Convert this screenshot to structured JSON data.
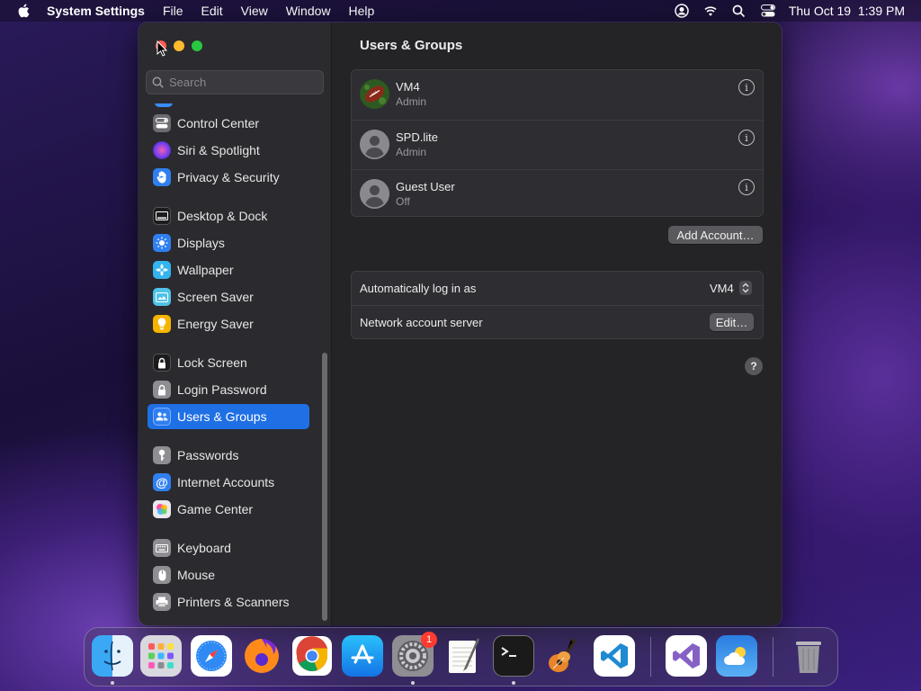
{
  "menubar": {
    "app_name": "System Settings",
    "menus": [
      "File",
      "Edit",
      "View",
      "Window",
      "Help"
    ],
    "clock": "Thu Oct 19  1:39 PM"
  },
  "sidebar": {
    "search_placeholder": "Search",
    "items": [
      {
        "label": "Control Center",
        "icon": "control-center-icon",
        "color": "#6b6b70"
      },
      {
        "label": "Siri & Spotlight",
        "icon": "siri-icon",
        "color": "#b14fd6"
      },
      {
        "label": "Privacy & Security",
        "icon": "hand-icon",
        "color": "#2f7ff0"
      },
      {
        "label": "Desktop & Dock",
        "icon": "dock-icon",
        "color": "#1c1c1e"
      },
      {
        "label": "Displays",
        "icon": "sun-icon",
        "color": "#2f7ff0"
      },
      {
        "label": "Wallpaper",
        "icon": "flower-icon",
        "color": "#33b4ee"
      },
      {
        "label": "Screen Saver",
        "icon": "screen-saver-icon",
        "color": "#4fc3e8"
      },
      {
        "label": "Energy Saver",
        "icon": "bulb-icon",
        "color": "#f5b400"
      },
      {
        "label": "Lock Screen",
        "icon": "lock-icon",
        "color": "#1c1c1e"
      },
      {
        "label": "Login Password",
        "icon": "padlock-icon",
        "color": "#8e8e93"
      },
      {
        "label": "Users & Groups",
        "icon": "users-icon",
        "color": "#2f7ff0"
      },
      {
        "label": "Passwords",
        "icon": "key-icon",
        "color": "#8e8e93"
      },
      {
        "label": "Internet Accounts",
        "icon": "at-icon",
        "color": "#2f7ff0"
      },
      {
        "label": "Game Center",
        "icon": "game-center-icon",
        "color": "#e9e9ee"
      },
      {
        "label": "Keyboard",
        "icon": "keyboard-icon",
        "color": "#8e8e93"
      },
      {
        "label": "Mouse",
        "icon": "mouse-icon",
        "color": "#8e8e93"
      },
      {
        "label": "Printers & Scanners",
        "icon": "printer-icon",
        "color": "#8e8e93"
      }
    ]
  },
  "main": {
    "title": "Users & Groups",
    "users": [
      {
        "name": "VM4",
        "role": "Admin",
        "avatar": "football-avatar"
      },
      {
        "name": "SPD.lite",
        "role": "Admin",
        "avatar": "generic-avatar"
      },
      {
        "name": "Guest User",
        "role": "Off",
        "avatar": "generic-avatar"
      }
    ],
    "add_account_label": "Add Account…",
    "auto_login_label": "Automatically log in as",
    "auto_login_value": "VM4",
    "network_server_label": "Network account server",
    "edit_label": "Edit…",
    "help_label": "?"
  },
  "dock": {
    "apps": [
      "Finder",
      "Launchpad",
      "Safari",
      "Firefox",
      "Chrome",
      "App Store",
      "System Settings",
      "TextEdit",
      "Terminal",
      "GarageBand",
      "Visual Studio Code",
      "Visual Studio",
      "Weather",
      "Trash"
    ],
    "settings_badge": "1"
  }
}
